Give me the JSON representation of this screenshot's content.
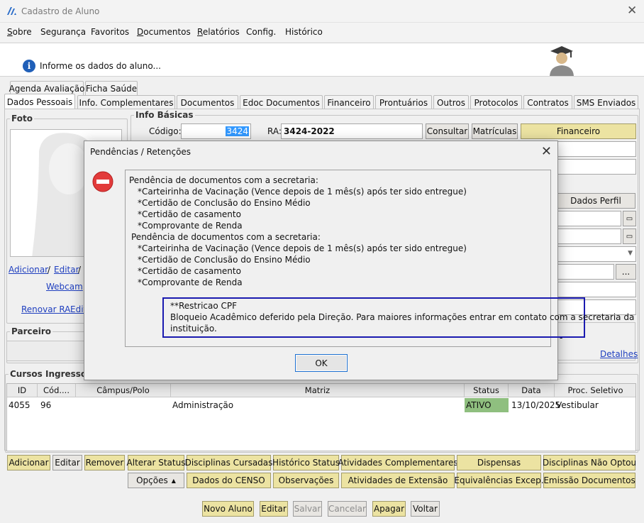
{
  "window": {
    "title": "Cadastro de Aluno"
  },
  "menu": [
    "Sobre",
    "Segurança",
    "Favoritos",
    "Documentos",
    "Relatórios",
    "Config.",
    "Histórico"
  ],
  "info_message": "Informe os dados do aluno...",
  "tabs_top": [
    "Agenda Avaliação",
    "Ficha Saúde"
  ],
  "tabs": [
    "Dados Pessoais",
    "Info. Complementares",
    "Documentos",
    "Edoc Documentos",
    "Financeiro",
    "Prontuários",
    "Outros",
    "Protocolos",
    "Contratos",
    "SMS Enviados"
  ],
  "foto": {
    "legend": "Foto",
    "adicionar": "Adicionar",
    "sep1": "/",
    "editar": "Editar",
    "sep2": "/",
    "webcam": "Webcam",
    "renovar_ra": "Renovar RA",
    "edit_cut": "Edit"
  },
  "info_basicas": {
    "legend": "Info Básicas",
    "codigo_label": "Código:",
    "codigo_value": "3424",
    "ra_label": "RA:",
    "ra_value": "3424-2022",
    "consultar": "Consultar",
    "matriculas": "Matrículas",
    "financeiro": "Financeiro",
    "dados_perfil": "Dados Perfil",
    "ellipsis": "...",
    "dash": "-",
    "detalhes": "Detalhes"
  },
  "parceiro": {
    "legend": "Parceiro"
  },
  "cursos": {
    "legend": "Cursos Ingresso",
    "columns": [
      "ID",
      "Cód....",
      "Câmpus/Polo",
      "Matriz",
      "Status",
      "Data",
      "Proc. Seletivo"
    ],
    "rows": [
      {
        "id": "4055",
        "cod": "96",
        "campus": "",
        "matriz": "Administração",
        "status": "ATIVO",
        "data": "13/10/2025",
        "proc": "Vestibular"
      }
    ]
  },
  "buttons_row1": [
    "Adicionar",
    "Editar",
    "Remover",
    "Alterar Status",
    "Disciplinas Cursadas",
    "Histórico Status",
    "Atividades Complementares",
    "Dispensas",
    "Disciplinas Não Optou"
  ],
  "buttons_row2": [
    "Opções",
    "Dados do CENSO",
    "Observações",
    "Atividades de Extensão",
    "Equivalências Excep.",
    "Emissão Documentos"
  ],
  "footer_buttons": [
    "Novo Aluno",
    "Editar",
    "Salvar",
    "Cancelar",
    "Apagar",
    "Voltar"
  ],
  "dialog": {
    "title": "Pendências / Retenções",
    "lines": [
      "Pendência de documentos com a secretaria:",
      "*Carteirinha de Vacinação (Vence depois de 1 mês(s) após ter sido entregue)",
      "*Certidão de Conclusão do Ensino Médio",
      "*Certidão de casamento",
      "*Comprovante de Renda",
      "Pendência de documentos com a secretaria:",
      "*Carteirinha de Vacinação (Vence depois de 1 mês(s) após ter sido entregue)",
      "*Certidão de Conclusão do Ensino Médio",
      "*Certidão de casamento",
      "*Comprovante de Renda"
    ],
    "restriction_title": "**Restricao CPF",
    "restriction_line1": "Bloqueio Acadêmico deferido pela Direção. Para maiores informações entrar em contato com a secretaria da",
    "restriction_line2": "instituição.",
    "ok": "OK"
  },
  "colors": {
    "yellow_button": "#ece3a2",
    "status_active": "#8fbf7f",
    "highlight": "#3399ff",
    "restriction_border": "#1a1ab0"
  }
}
